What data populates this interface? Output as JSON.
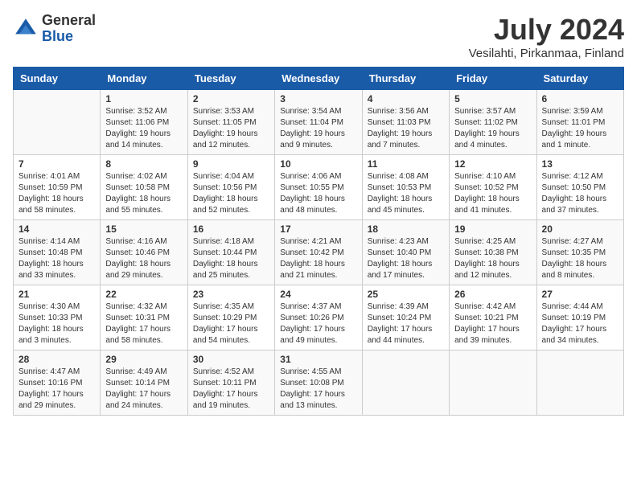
{
  "header": {
    "logo_general": "General",
    "logo_blue": "Blue",
    "month_year": "July 2024",
    "location": "Vesilahti, Pirkanmaa, Finland"
  },
  "days_of_week": [
    "Sunday",
    "Monday",
    "Tuesday",
    "Wednesday",
    "Thursday",
    "Friday",
    "Saturday"
  ],
  "weeks": [
    [
      {
        "day": "",
        "info": ""
      },
      {
        "day": "1",
        "info": "Sunrise: 3:52 AM\nSunset: 11:06 PM\nDaylight: 19 hours\nand 14 minutes."
      },
      {
        "day": "2",
        "info": "Sunrise: 3:53 AM\nSunset: 11:05 PM\nDaylight: 19 hours\nand 12 minutes."
      },
      {
        "day": "3",
        "info": "Sunrise: 3:54 AM\nSunset: 11:04 PM\nDaylight: 19 hours\nand 9 minutes."
      },
      {
        "day": "4",
        "info": "Sunrise: 3:56 AM\nSunset: 11:03 PM\nDaylight: 19 hours\nand 7 minutes."
      },
      {
        "day": "5",
        "info": "Sunrise: 3:57 AM\nSunset: 11:02 PM\nDaylight: 19 hours\nand 4 minutes."
      },
      {
        "day": "6",
        "info": "Sunrise: 3:59 AM\nSunset: 11:01 PM\nDaylight: 19 hours\nand 1 minute."
      }
    ],
    [
      {
        "day": "7",
        "info": "Sunrise: 4:01 AM\nSunset: 10:59 PM\nDaylight: 18 hours\nand 58 minutes."
      },
      {
        "day": "8",
        "info": "Sunrise: 4:02 AM\nSunset: 10:58 PM\nDaylight: 18 hours\nand 55 minutes."
      },
      {
        "day": "9",
        "info": "Sunrise: 4:04 AM\nSunset: 10:56 PM\nDaylight: 18 hours\nand 52 minutes."
      },
      {
        "day": "10",
        "info": "Sunrise: 4:06 AM\nSunset: 10:55 PM\nDaylight: 18 hours\nand 48 minutes."
      },
      {
        "day": "11",
        "info": "Sunrise: 4:08 AM\nSunset: 10:53 PM\nDaylight: 18 hours\nand 45 minutes."
      },
      {
        "day": "12",
        "info": "Sunrise: 4:10 AM\nSunset: 10:52 PM\nDaylight: 18 hours\nand 41 minutes."
      },
      {
        "day": "13",
        "info": "Sunrise: 4:12 AM\nSunset: 10:50 PM\nDaylight: 18 hours\nand 37 minutes."
      }
    ],
    [
      {
        "day": "14",
        "info": "Sunrise: 4:14 AM\nSunset: 10:48 PM\nDaylight: 18 hours\nand 33 minutes."
      },
      {
        "day": "15",
        "info": "Sunrise: 4:16 AM\nSunset: 10:46 PM\nDaylight: 18 hours\nand 29 minutes."
      },
      {
        "day": "16",
        "info": "Sunrise: 4:18 AM\nSunset: 10:44 PM\nDaylight: 18 hours\nand 25 minutes."
      },
      {
        "day": "17",
        "info": "Sunrise: 4:21 AM\nSunset: 10:42 PM\nDaylight: 18 hours\nand 21 minutes."
      },
      {
        "day": "18",
        "info": "Sunrise: 4:23 AM\nSunset: 10:40 PM\nDaylight: 18 hours\nand 17 minutes."
      },
      {
        "day": "19",
        "info": "Sunrise: 4:25 AM\nSunset: 10:38 PM\nDaylight: 18 hours\nand 12 minutes."
      },
      {
        "day": "20",
        "info": "Sunrise: 4:27 AM\nSunset: 10:35 PM\nDaylight: 18 hours\nand 8 minutes."
      }
    ],
    [
      {
        "day": "21",
        "info": "Sunrise: 4:30 AM\nSunset: 10:33 PM\nDaylight: 18 hours\nand 3 minutes."
      },
      {
        "day": "22",
        "info": "Sunrise: 4:32 AM\nSunset: 10:31 PM\nDaylight: 17 hours\nand 58 minutes."
      },
      {
        "day": "23",
        "info": "Sunrise: 4:35 AM\nSunset: 10:29 PM\nDaylight: 17 hours\nand 54 minutes."
      },
      {
        "day": "24",
        "info": "Sunrise: 4:37 AM\nSunset: 10:26 PM\nDaylight: 17 hours\nand 49 minutes."
      },
      {
        "day": "25",
        "info": "Sunrise: 4:39 AM\nSunset: 10:24 PM\nDaylight: 17 hours\nand 44 minutes."
      },
      {
        "day": "26",
        "info": "Sunrise: 4:42 AM\nSunset: 10:21 PM\nDaylight: 17 hours\nand 39 minutes."
      },
      {
        "day": "27",
        "info": "Sunrise: 4:44 AM\nSunset: 10:19 PM\nDaylight: 17 hours\nand 34 minutes."
      }
    ],
    [
      {
        "day": "28",
        "info": "Sunrise: 4:47 AM\nSunset: 10:16 PM\nDaylight: 17 hours\nand 29 minutes."
      },
      {
        "day": "29",
        "info": "Sunrise: 4:49 AM\nSunset: 10:14 PM\nDaylight: 17 hours\nand 24 minutes."
      },
      {
        "day": "30",
        "info": "Sunrise: 4:52 AM\nSunset: 10:11 PM\nDaylight: 17 hours\nand 19 minutes."
      },
      {
        "day": "31",
        "info": "Sunrise: 4:55 AM\nSunset: 10:08 PM\nDaylight: 17 hours\nand 13 minutes."
      },
      {
        "day": "",
        "info": ""
      },
      {
        "day": "",
        "info": ""
      },
      {
        "day": "",
        "info": ""
      }
    ]
  ]
}
